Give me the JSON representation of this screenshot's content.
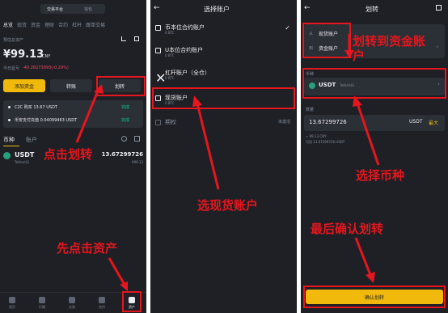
{
  "panel1": {
    "tabs": [
      "交易平台",
      "钱包"
    ],
    "nav": [
      "总览",
      "现货",
      "资金",
      "理财",
      "合约",
      "杠杆",
      "跟单交易"
    ],
    "est_label": "预估总资产",
    "balance": "¥99.13",
    "currency": "CNY",
    "pnl_label": "今日盈亏",
    "pnl_value": "-40.28273093(-0.29%)",
    "btn_add": "添加资金",
    "btn_convert": "转账",
    "btn_transfer": "划转",
    "notice1": "C2C 购买 13.67 USDT",
    "notice2": "币安支付充值 0.04099463 USDT",
    "notice_status": "完成",
    "list_tabs": [
      "币种",
      "账户"
    ],
    "coin_name": "USDT",
    "coin_full": "TetherUS",
    "coin_amount": "13.67299726",
    "coin_cny": "¥99.13",
    "bottom_nav": [
      "首页",
      "行情",
      "交易",
      "合约",
      "资产"
    ],
    "annot_click_transfer": "点击划转",
    "annot_click_assets": "先点击资产"
  },
  "panel2": {
    "title": "选择账户",
    "accounts": [
      {
        "name": "币本位合约账户",
        "sub": "0 BTC"
      },
      {
        "name": "U本位合约账户",
        "sub": "0 BTC"
      },
      {
        "name": "杠杆账户（全仓）",
        "sub": "0 BTC"
      },
      {
        "name": "现货账户",
        "sub": "0 BTC"
      }
    ],
    "disabled_name": "期权",
    "disabled_status": "未激活",
    "annot": "选现货账户"
  },
  "panel3": {
    "title": "划转",
    "from_label": "从",
    "from_value": "现货账户",
    "to_label": "到",
    "to_value": "资金账户",
    "coin_label": "币种",
    "coin_name": "USDT",
    "coin_full": "TetherUS",
    "amount_label": "数量",
    "amount_value": "13.67299726",
    "amount_unit": "USDT",
    "max_label": "最大",
    "hint1": "≈ 99.13 CNY",
    "hint2": "可用 13.67299726 USDT",
    "confirm": "确认划转",
    "annot_to_fund": "划转到资金账",
    "annot_to_fund2": "户",
    "annot_coin": "选择币种",
    "annot_confirm": "最后确认划转"
  }
}
